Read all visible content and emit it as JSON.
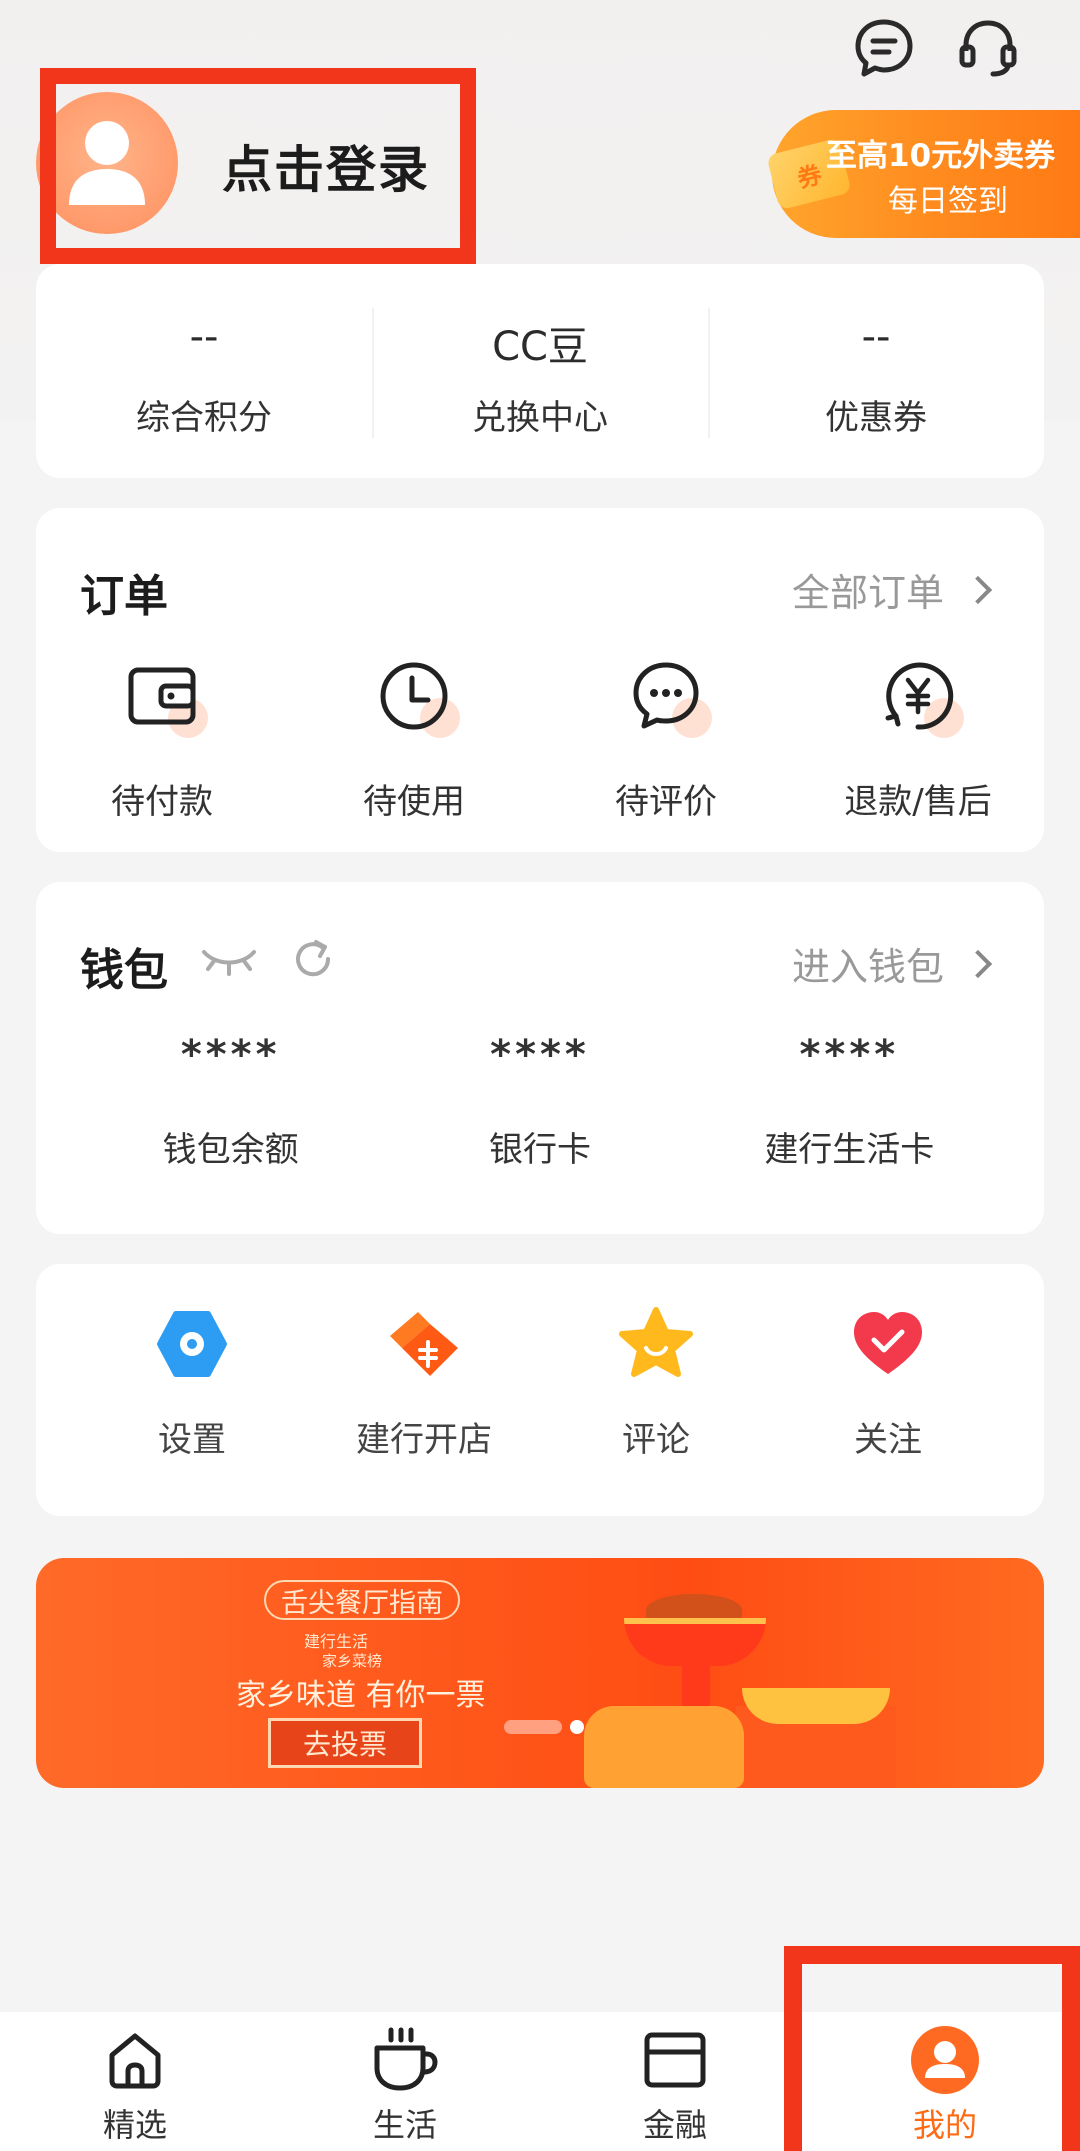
{
  "header": {
    "login_text": "点击登录",
    "coupon_title": "至高10元外卖券",
    "coupon_subtitle": "每日签到",
    "coupon_badge": "券",
    "colors": {
      "accent": "#ff7a14",
      "highlight": "#f2361c"
    }
  },
  "stats": [
    {
      "value": "--",
      "label": "综合积分"
    },
    {
      "value": "CC豆",
      "label": "兑换中心"
    },
    {
      "value": "--",
      "label": "优惠券"
    }
  ],
  "orders": {
    "title": "订单",
    "link": "全部订单",
    "items": [
      {
        "label": "待付款",
        "icon": "wallet-icon"
      },
      {
        "label": "待使用",
        "icon": "clock-icon"
      },
      {
        "label": "待评价",
        "icon": "chat-icon"
      },
      {
        "label": "退款/售后",
        "icon": "refund-icon"
      }
    ]
  },
  "wallet": {
    "title": "钱包",
    "link": "进入钱包",
    "items": [
      {
        "value": "****",
        "label": "钱包余额"
      },
      {
        "value": "****",
        "label": "银行卡"
      },
      {
        "value": "****",
        "label": "建行生活卡"
      }
    ]
  },
  "tools": [
    {
      "label": "设置",
      "icon": "settings-icon"
    },
    {
      "label": "建行开店",
      "icon": "shop-icon"
    },
    {
      "label": "评论",
      "icon": "star-icon"
    },
    {
      "label": "关注",
      "icon": "heart-icon"
    }
  ],
  "banner": {
    "tag": "舌尖餐厅指南",
    "brand": "建行生活",
    "sub": "家乡菜榜",
    "headline": "家乡味道 有你一票",
    "button": "去投票"
  },
  "tabbar": [
    {
      "label": "精选",
      "icon": "home-icon"
    },
    {
      "label": "生活",
      "icon": "coffee-icon"
    },
    {
      "label": "金融",
      "icon": "card-icon"
    },
    {
      "label": "我的",
      "icon": "profile-icon",
      "active": true
    }
  ]
}
